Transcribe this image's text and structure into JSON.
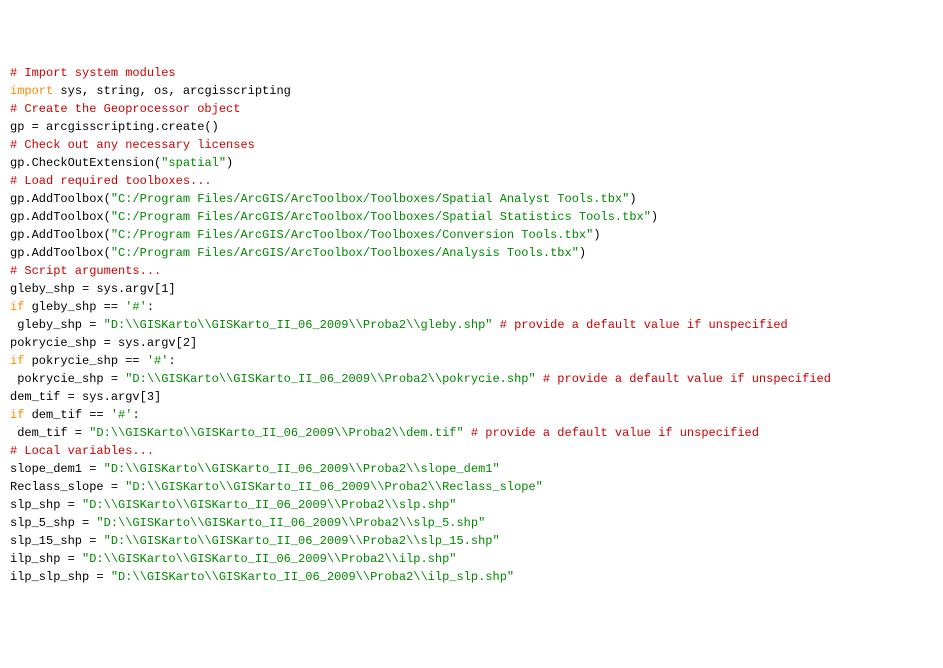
{
  "lines": [
    {
      "tokens": [
        {
          "cls": "comment",
          "text": "# Import system modules"
        }
      ]
    },
    {
      "tokens": [
        {
          "cls": "keyword",
          "text": "import"
        },
        {
          "cls": "",
          "text": " sys, string, os, arcgisscripting"
        }
      ]
    },
    {
      "tokens": [
        {
          "cls": "",
          "text": ""
        }
      ]
    },
    {
      "tokens": [
        {
          "cls": "comment",
          "text": "# Create the Geoprocessor object"
        }
      ]
    },
    {
      "tokens": [
        {
          "cls": "",
          "text": "gp = arcgisscripting.create()"
        }
      ]
    },
    {
      "tokens": [
        {
          "cls": "",
          "text": ""
        }
      ]
    },
    {
      "tokens": [
        {
          "cls": "cursor",
          "text": "#"
        },
        {
          "cls": "comment",
          "text": " Check out any necessary licenses"
        }
      ]
    },
    {
      "tokens": [
        {
          "cls": "",
          "text": "gp.CheckOutExtension("
        },
        {
          "cls": "string",
          "text": "\"spatial\""
        },
        {
          "cls": "",
          "text": ")"
        }
      ]
    },
    {
      "tokens": [
        {
          "cls": "",
          "text": ""
        }
      ]
    },
    {
      "tokens": [
        {
          "cls": "comment",
          "text": "# Load required toolboxes..."
        }
      ]
    },
    {
      "tokens": [
        {
          "cls": "",
          "text": "gp.AddToolbox("
        },
        {
          "cls": "string",
          "text": "\"C:/Program Files/ArcGIS/ArcToolbox/Toolboxes/Spatial Analyst Tools.tbx\""
        },
        {
          "cls": "",
          "text": ")"
        }
      ]
    },
    {
      "tokens": [
        {
          "cls": "",
          "text": "gp.AddToolbox("
        },
        {
          "cls": "string",
          "text": "\"C:/Program Files/ArcGIS/ArcToolbox/Toolboxes/Spatial Statistics Tools.tbx\""
        },
        {
          "cls": "",
          "text": ")"
        }
      ]
    },
    {
      "tokens": [
        {
          "cls": "",
          "text": "gp.AddToolbox("
        },
        {
          "cls": "string",
          "text": "\"C:/Program Files/ArcGIS/ArcToolbox/Toolboxes/Conversion Tools.tbx\""
        },
        {
          "cls": "",
          "text": ")"
        }
      ]
    },
    {
      "tokens": [
        {
          "cls": "",
          "text": "gp.AddToolbox("
        },
        {
          "cls": "string",
          "text": "\"C:/Program Files/ArcGIS/ArcToolbox/Toolboxes/Analysis Tools.tbx\""
        },
        {
          "cls": "",
          "text": ")"
        }
      ]
    },
    {
      "tokens": [
        {
          "cls": "",
          "text": ""
        }
      ]
    },
    {
      "tokens": [
        {
          "cls": "comment",
          "text": "# Script arguments..."
        }
      ]
    },
    {
      "tokens": [
        {
          "cls": "",
          "text": "gleby_shp = sys.argv[1]"
        }
      ]
    },
    {
      "tokens": [
        {
          "cls": "keyword",
          "text": "if"
        },
        {
          "cls": "",
          "text": " gleby_shp == "
        },
        {
          "cls": "string",
          "text": "'#'"
        },
        {
          "cls": "",
          "text": ":"
        }
      ]
    },
    {
      "tokens": [
        {
          "cls": "",
          "text": " gleby_shp = "
        },
        {
          "cls": "string",
          "text": "\"D:\\\\GISKarto\\\\GISKarto_II_06_2009\\\\Proba2\\\\gleby.shp\""
        },
        {
          "cls": "",
          "text": " "
        },
        {
          "cls": "comment",
          "text": "# provide a default value if unspecified"
        }
      ]
    },
    {
      "tokens": [
        {
          "cls": "",
          "text": ""
        }
      ]
    },
    {
      "tokens": [
        {
          "cls": "",
          "text": "pokrycie_shp = sys.argv[2]"
        }
      ]
    },
    {
      "tokens": [
        {
          "cls": "keyword",
          "text": "if"
        },
        {
          "cls": "",
          "text": " pokrycie_shp == "
        },
        {
          "cls": "string",
          "text": "'#'"
        },
        {
          "cls": "",
          "text": ":"
        }
      ]
    },
    {
      "tokens": [
        {
          "cls": "",
          "text": " pokrycie_shp = "
        },
        {
          "cls": "string",
          "text": "\"D:\\\\GISKarto\\\\GISKarto_II_06_2009\\\\Proba2\\\\pokrycie.shp\""
        },
        {
          "cls": "",
          "text": " "
        },
        {
          "cls": "comment",
          "text": "# provide a default value if unspecified"
        }
      ]
    },
    {
      "tokens": [
        {
          "cls": "",
          "text": ""
        }
      ]
    },
    {
      "tokens": [
        {
          "cls": "",
          "text": "dem_tif = sys.argv[3]"
        }
      ]
    },
    {
      "tokens": [
        {
          "cls": "keyword",
          "text": "if"
        },
        {
          "cls": "",
          "text": " dem_tif == "
        },
        {
          "cls": "string",
          "text": "'#'"
        },
        {
          "cls": "",
          "text": ":"
        }
      ]
    },
    {
      "tokens": [
        {
          "cls": "",
          "text": " dem_tif = "
        },
        {
          "cls": "string",
          "text": "\"D:\\\\GISKarto\\\\GISKarto_II_06_2009\\\\Proba2\\\\dem.tif\""
        },
        {
          "cls": "",
          "text": " "
        },
        {
          "cls": "comment",
          "text": "# provide a default value if unspecified"
        }
      ]
    },
    {
      "tokens": [
        {
          "cls": "",
          "text": ""
        }
      ]
    },
    {
      "tokens": [
        {
          "cls": "comment",
          "text": "# Local variables..."
        }
      ]
    },
    {
      "tokens": [
        {
          "cls": "",
          "text": "slope_dem1 = "
        },
        {
          "cls": "string",
          "text": "\"D:\\\\GISKarto\\\\GISKarto_II_06_2009\\\\Proba2\\\\slope_dem1\""
        }
      ]
    },
    {
      "tokens": [
        {
          "cls": "",
          "text": "Reclass_slope = "
        },
        {
          "cls": "string",
          "text": "\"D:\\\\GISKarto\\\\GISKarto_II_06_2009\\\\Proba2\\\\Reclass_slope\""
        }
      ]
    },
    {
      "tokens": [
        {
          "cls": "",
          "text": "slp_shp = "
        },
        {
          "cls": "string",
          "text": "\"D:\\\\GISKarto\\\\GISKarto_II_06_2009\\\\Proba2\\\\slp.shp\""
        }
      ]
    },
    {
      "tokens": [
        {
          "cls": "",
          "text": "slp_5_shp = "
        },
        {
          "cls": "string",
          "text": "\"D:\\\\GISKarto\\\\GISKarto_II_06_2009\\\\Proba2\\\\slp_5.shp\""
        }
      ]
    },
    {
      "tokens": [
        {
          "cls": "",
          "text": "slp_15_shp = "
        },
        {
          "cls": "string",
          "text": "\"D:\\\\GISKarto\\\\GISKarto_II_06_2009\\\\Proba2\\\\slp_15.shp\""
        }
      ]
    },
    {
      "tokens": [
        {
          "cls": "",
          "text": "ilp_shp = "
        },
        {
          "cls": "string",
          "text": "\"D:\\\\GISKarto\\\\GISKarto_II_06_2009\\\\Proba2\\\\ilp.shp\""
        }
      ]
    },
    {
      "tokens": [
        {
          "cls": "",
          "text": "ilp_slp_shp = "
        },
        {
          "cls": "string",
          "text": "\"D:\\\\GISKarto\\\\GISKarto_II_06_2009\\\\Proba2\\\\ilp_slp.shp\""
        }
      ]
    }
  ]
}
